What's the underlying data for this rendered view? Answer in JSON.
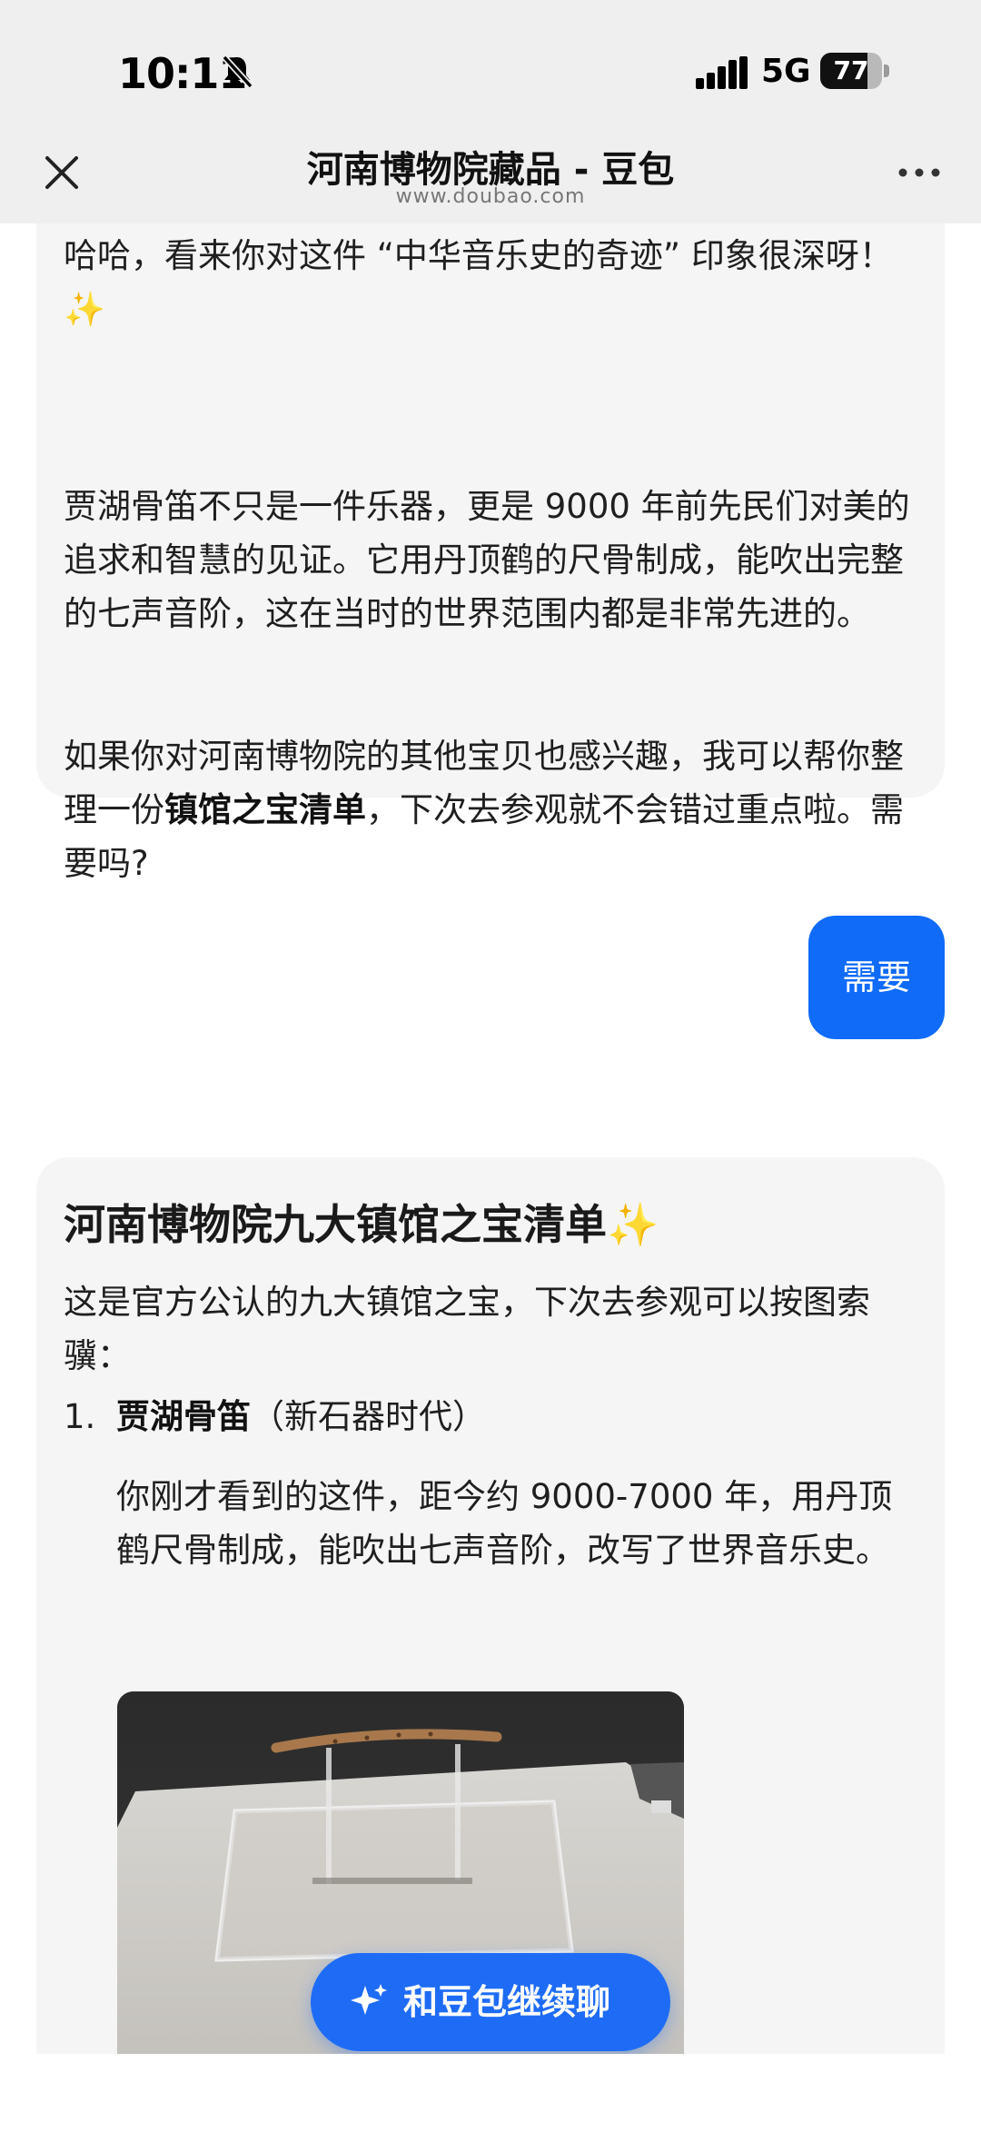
{
  "status_bar": {
    "time": "10:11",
    "network": "5G",
    "battery_level": "77",
    "battery_fraction": 0.77
  },
  "nav": {
    "title": "河南博物院藏品 - 豆包",
    "subtitle": "www.doubao.com"
  },
  "messages": {
    "assistant_reply_1": {
      "para1": "哈哈，看来你对这件 “中华音乐史的奇迹” 印象很深呀！",
      "para1_emoji": "✨",
      "para2": "贾湖骨笛不只是一件乐器，更是 9000 年前先民们对美的追求和智慧的见证。它用丹顶鹤的尺骨制成，能吹出完整的七声音阶，这在当时的世界范围内都是非常先进的。",
      "para3_before": "如果你对河南博物院的其他宝贝也感兴趣，我可以帮你整理一份",
      "para3_bold": "镇馆之宝清单",
      "para3_after": "，下次去参观就不会错过重点啦。需要吗?"
    },
    "user_message": "需要",
    "assistant_reply_2": {
      "title": "河南博物院九大镇馆之宝清单",
      "title_emoji": "✨",
      "intro": "这是官方公认的九大镇馆之宝，下次去参观可以按图索骥：",
      "items": [
        {
          "number": "1.",
          "name": "贾湖骨笛",
          "era": "（新石器时代）",
          "description": "你刚才看到的这件，距今约 9000-7000 年，用丹顶鹤尺骨制成，能吹出七声音阶，改写了世界音乐史。"
        }
      ]
    }
  },
  "continue_button": {
    "label": "和豆包继续聊"
  },
  "icons": {
    "close": "close-icon",
    "more": "more-icon",
    "bell_muted": "bell-muted-icon",
    "signal": "signal-icon",
    "sparkle": "sparkle-icon"
  },
  "colors": {
    "accent": "#1e6cf5",
    "user_bubble": "#0f6bf8",
    "bubble_bg": "#f5f5f5",
    "header_bg": "#efefef"
  }
}
